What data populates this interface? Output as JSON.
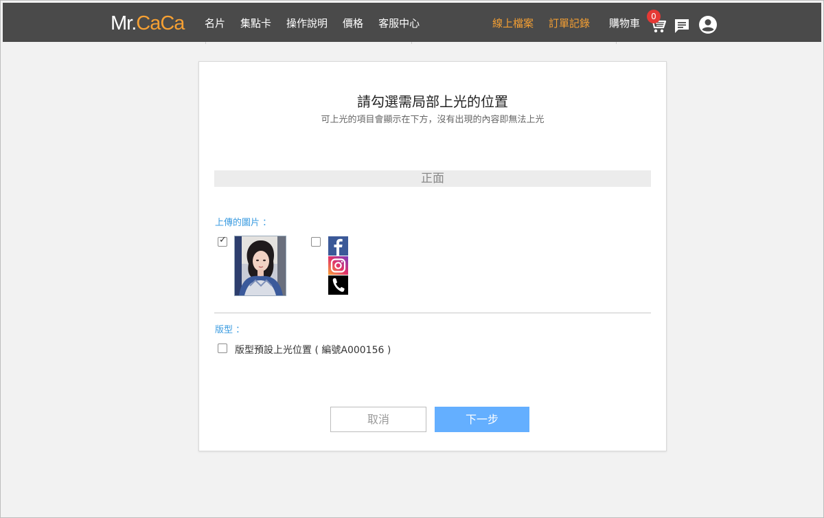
{
  "header": {
    "logo_mr": "Mr.",
    "logo_caca": "CaCa",
    "nav_left": [
      "名片",
      "集點卡",
      "操作說明",
      "價格",
      "客服中心"
    ],
    "nav_right": [
      "線上檔案",
      "訂單記錄"
    ],
    "cart_label": "購物車",
    "cart_count": "0",
    "icons": [
      "cart-icon",
      "message-icon",
      "account-icon"
    ],
    "accent_color": "#f6a033",
    "bar_color": "#4a4a4a"
  },
  "dialog": {
    "title": "請勾選需局部上光的位置",
    "subtitle": "可上光的項目會顯示在下方，沒有出現的內容即無法上光",
    "side_label": "正面",
    "uploaded_label": "上傳的圖片 ：",
    "template_label": "版型 ：",
    "template_option": "版型預設上光位置 ( 編號A000156 )",
    "images": [
      {
        "name": "photo",
        "checked": true
      },
      {
        "name": "social-icons",
        "checked": false
      }
    ],
    "template_checked": false,
    "cancel_label": "取消",
    "next_label": "下一步",
    "label_color": "#3a9be0",
    "next_color": "#64afff"
  }
}
